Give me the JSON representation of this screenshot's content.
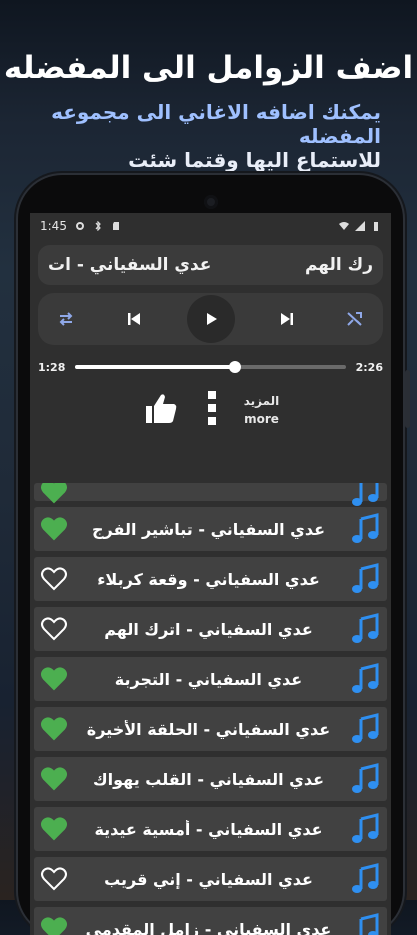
{
  "promo": {
    "title": "اضف الزوامل الى المفضله",
    "subtitle_line1": "يمكنك اضافه الاغاني الى مجموعه المفضله",
    "subtitle_line2": "للاستماع اليها وقتما شئت"
  },
  "status_bar": {
    "time": "1:45"
  },
  "now_playing": {
    "right_text": "رك الهم",
    "left_text": "عدي السفياني - ات"
  },
  "player": {
    "elapsed": "1:28",
    "duration": "2:26",
    "progress": 0.59
  },
  "actions": {
    "more_label_ar": "المزيد",
    "more_label_en": "more"
  },
  "songs": [
    {
      "title": "",
      "favorite": true,
      "partial": true
    },
    {
      "title": "عدي السفياني - تباشير الفرج",
      "favorite": true
    },
    {
      "title": "عدي السفياني - وقعة كربلاء",
      "favorite": false
    },
    {
      "title": "عدي السفياني - اترك الهم",
      "favorite": false
    },
    {
      "title": "عدي السفياني - التجربة",
      "favorite": true
    },
    {
      "title": "عدي السفياني - الحلقة الأخيرة",
      "favorite": true
    },
    {
      "title": "عدي السفياني - القلب يهواك",
      "favorite": true
    },
    {
      "title": "عدي السفياني - أمسية عيدية",
      "favorite": true
    },
    {
      "title": "عدي السفياني - إني قريب",
      "favorite": false
    },
    {
      "title": "عدي السفياني - زامل المقدمي",
      "favorite": true
    }
  ],
  "colors": {
    "heart_fav": "#4caf50",
    "note": "#2f8ff0",
    "row_bg": "#414141"
  }
}
